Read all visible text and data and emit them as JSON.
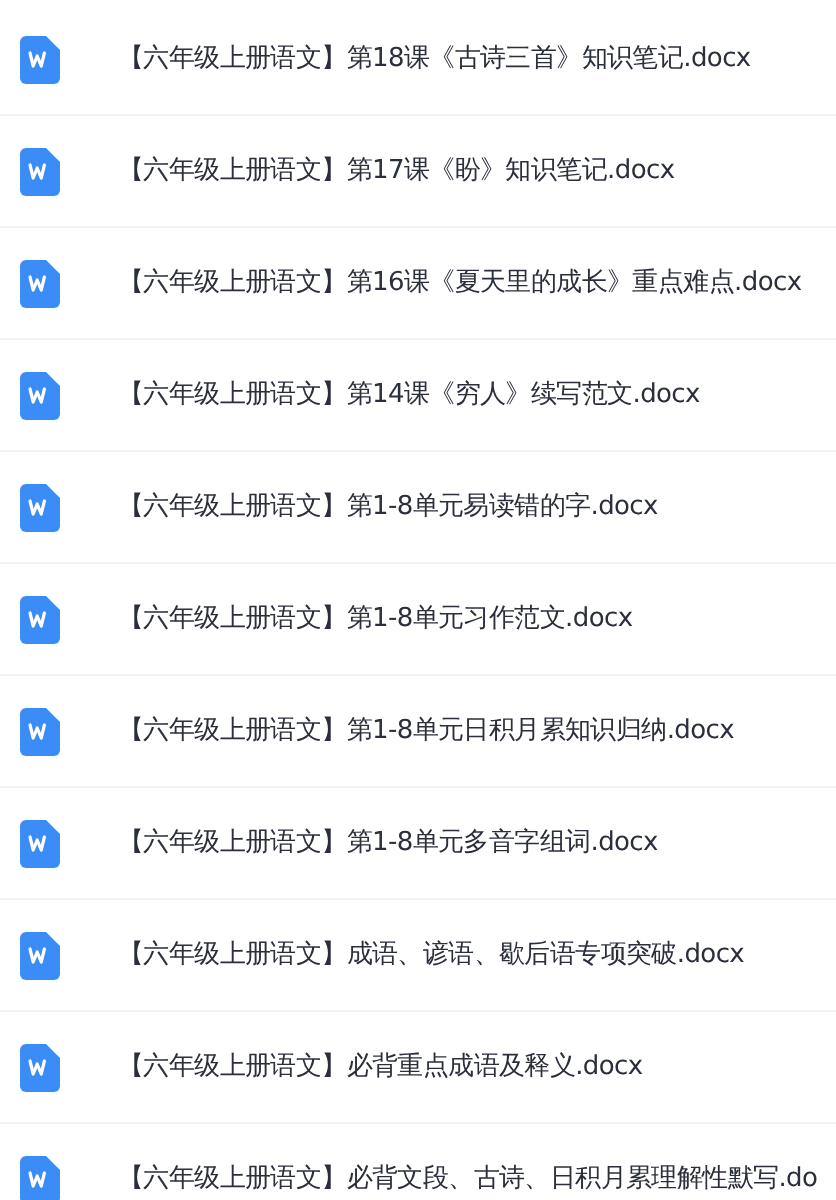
{
  "files": [
    {
      "name": "【六年级上册语文】第18课《古诗三首》知识笔记.docx"
    },
    {
      "name": "【六年级上册语文】第17课《盼》知识笔记.docx"
    },
    {
      "name": "【六年级上册语文】第16课《夏天里的成长》重点难点.docx"
    },
    {
      "name": "【六年级上册语文】第14课《穷人》续写范文.docx"
    },
    {
      "name": "【六年级上册语文】第1-8单元易读错的字.docx"
    },
    {
      "name": "【六年级上册语文】第1-8单元习作范文.docx"
    },
    {
      "name": "【六年级上册语文】第1-8单元日积月累知识归纳.docx"
    },
    {
      "name": "【六年级上册语文】第1-8单元多音字组词.docx"
    },
    {
      "name": "【六年级上册语文】成语、谚语、歇后语专项突破.docx"
    },
    {
      "name": "【六年级上册语文】必背重点成语及释义.docx"
    },
    {
      "name": "【六年级上册语文】必背文段、古诗、日积月累理解性默写.do"
    }
  ]
}
